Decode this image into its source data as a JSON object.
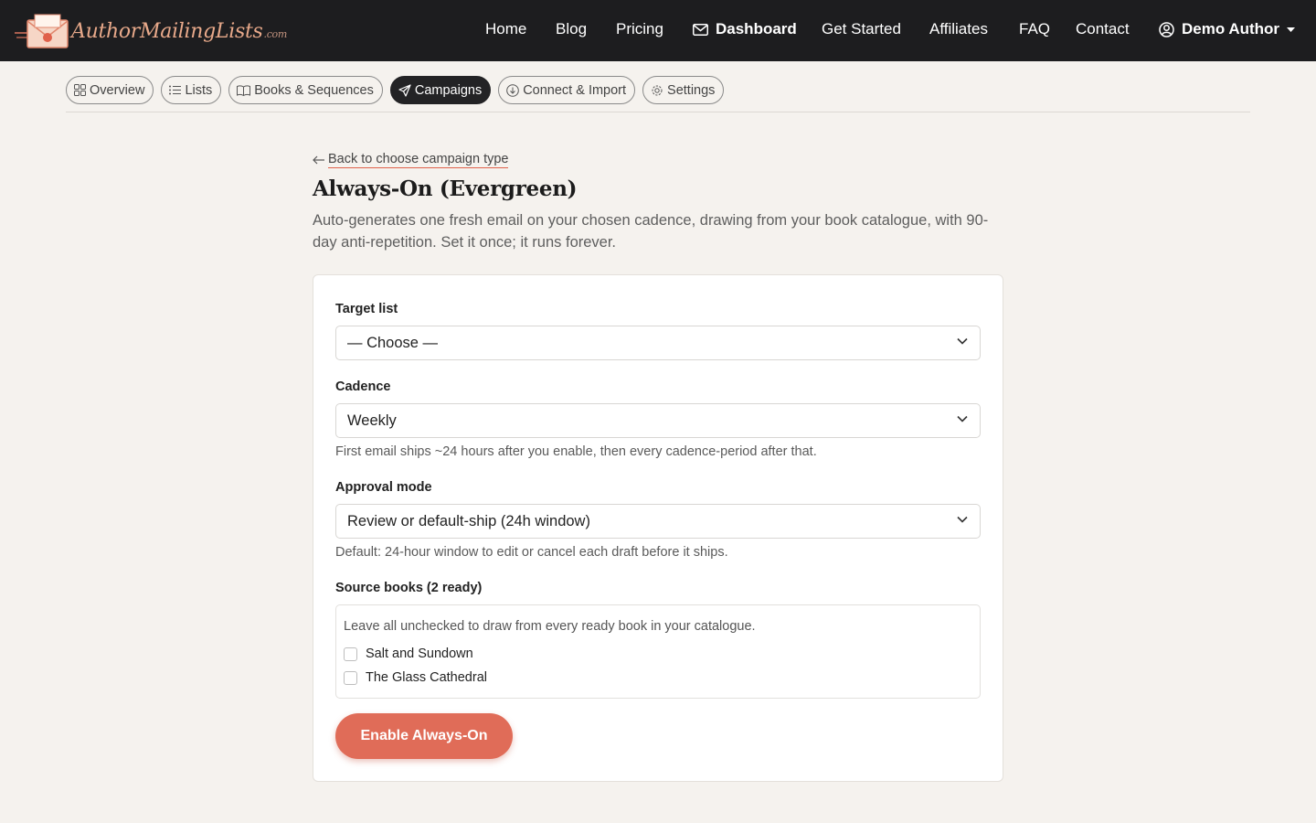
{
  "brand": {
    "name": "AuthorMailingLists",
    "suffix": ".com"
  },
  "nav": {
    "home": "Home",
    "blog": "Blog",
    "pricing": "Pricing",
    "dashboard": "Dashboard",
    "get_started": "Get Started",
    "affiliates": "Affiliates",
    "faq": "FAQ",
    "contact": "Contact",
    "user": "Demo Author"
  },
  "tabs": [
    {
      "label": "Overview",
      "icon": "grid-icon"
    },
    {
      "label": "Lists",
      "icon": "list-icon"
    },
    {
      "label": "Books & Sequences",
      "icon": "book-icon"
    },
    {
      "label": "Campaigns",
      "icon": "send-icon",
      "active": true
    },
    {
      "label": "Connect & Import",
      "icon": "download-icon"
    },
    {
      "label": "Settings",
      "icon": "gear-icon"
    }
  ],
  "page": {
    "back_link": "Back to choose campaign type",
    "title": "Always-On (Evergreen)",
    "description": "Auto-generates one fresh email on your chosen cadence, drawing from your book catalogue, with 90-day anti-repetition. Set it once; it runs forever."
  },
  "form": {
    "target_list": {
      "label": "Target list",
      "value": "— Choose —"
    },
    "cadence": {
      "label": "Cadence",
      "value": "Weekly",
      "help": "First email ships ~24 hours after you enable, then every cadence-period after that."
    },
    "approval": {
      "label": "Approval mode",
      "value": "Review or default-ship (24h window)",
      "help": "Default: 24-hour window to edit or cancel each draft before it ships."
    },
    "source_books": {
      "label": "Source books (2 ready)",
      "note": "Leave all unchecked to draw from every ready book in your catalogue.",
      "books": [
        "Salt and Sundown",
        "The Glass Cathedral"
      ]
    },
    "submit": "Enable Always-On"
  },
  "colors": {
    "accent": "#e06c58",
    "nav_bg": "#1d1d1f",
    "page_bg": "#f5f2ee"
  }
}
